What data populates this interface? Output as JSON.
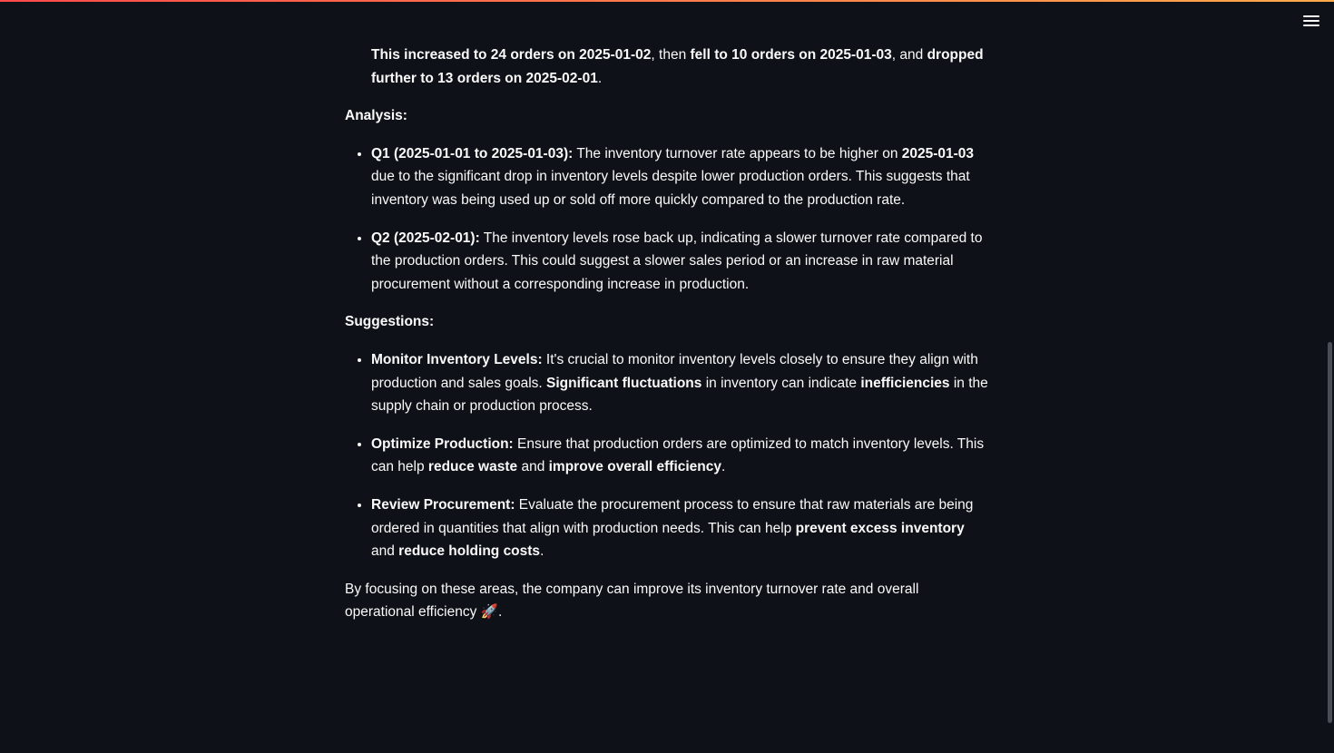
{
  "accent": {
    "gradient_start": "#ff4b4b",
    "gradient_end": "#fdaa4b",
    "background": "#0e1117"
  },
  "menu": {
    "icon": "hamburger-menu-icon"
  },
  "top_para": {
    "s1": "This increased to 24 orders on 2025-01-02",
    "s2": ", then ",
    "s3": "fell to 10 orders on 2025-01-03",
    "s4": ", and ",
    "s5": "dropped further to 13 orders on 2025-02-01",
    "s6": "."
  },
  "analysis": {
    "heading": "Analysis:",
    "items": [
      {
        "b1": "Q1 (2025-01-01 to 2025-01-03):",
        "t1": " The inventory turnover rate appears to be higher on ",
        "b2": "2025-01-03",
        "t2": " due to the significant drop in inventory levels despite lower production orders. This suggests that inventory was being used up or sold off more quickly compared to the production rate."
      },
      {
        "b1": "Q2 (2025-02-01):",
        "t1": " The inventory levels rose back up, indicating a slower turnover rate compared to the production orders. This could suggest a slower sales period or an increase in raw material procurement without a corresponding increase in production."
      }
    ]
  },
  "suggestions": {
    "heading": "Suggestions:",
    "items": [
      {
        "b1": "Monitor Inventory Levels:",
        "t1": " It's crucial to monitor inventory levels closely to ensure they align with production and sales goals. ",
        "b2": "Significant fluctuations",
        "t2": " in inventory can indicate ",
        "b3": "inefficiencies",
        "t3": " in the supply chain or production process."
      },
      {
        "b1": "Optimize Production:",
        "t1": " Ensure that production orders are optimized to match inventory levels. This can help ",
        "b2": "reduce waste",
        "t2": " and ",
        "b3": "improve overall efficiency",
        "t3": "."
      },
      {
        "b1": "Review Procurement:",
        "t1": " Evaluate the procurement process to ensure that raw materials are being ordered in quantities that align with production needs. This can help ",
        "b2": "prevent excess inventory",
        "t2": " and ",
        "b3": "reduce holding costs",
        "t3": "."
      }
    ]
  },
  "closing": {
    "text": "By focusing on these areas, the company can improve its inventory turnover rate and overall operational efficiency ",
    "emoji": "🚀",
    "end": "."
  }
}
